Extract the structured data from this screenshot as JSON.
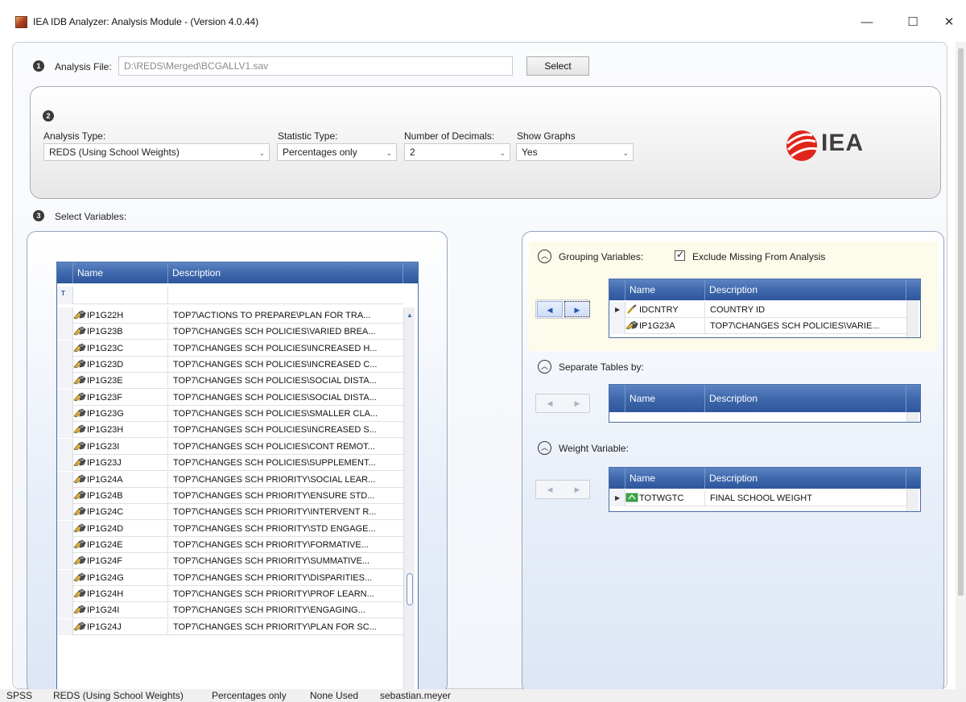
{
  "window": {
    "title": "IEA IDB Analyzer: Analysis Module - (Version 4.0.44)",
    "minimize": "—",
    "maximize": "☐",
    "close": "✕"
  },
  "step1": {
    "badge": "1",
    "label": "Analysis File:",
    "value": "D:\\REDS\\Merged\\BCGALLV1.sav",
    "select_button": "Select"
  },
  "step2": {
    "badge": "2",
    "analysis_type_label": "Analysis Type:",
    "analysis_type_value": "REDS (Using School Weights)",
    "statistic_type_label": "Statistic Type:",
    "statistic_type_value": "Percentages only",
    "decimals_label": "Number of Decimals:",
    "decimals_value": "2",
    "show_graphs_label": "Show Graphs",
    "show_graphs_value": "Yes",
    "logo_text": "IEA"
  },
  "step3": {
    "badge": "3",
    "label": "Select Variables:"
  },
  "variables_grid": {
    "columns": [
      "Name",
      "Description"
    ],
    "filter_symbol": "T",
    "rows": [
      {
        "name": "IP1G22H",
        "desc": "TOP7\\ACTIONS TO PREPARE\\PLAN FOR TRA..."
      },
      {
        "name": "IP1G23B",
        "desc": "TOP7\\CHANGES SCH POLICIES\\VARIED BREA..."
      },
      {
        "name": "IP1G23C",
        "desc": "TOP7\\CHANGES SCH POLICIES\\INCREASED H..."
      },
      {
        "name": "IP1G23D",
        "desc": "TOP7\\CHANGES SCH POLICIES\\INCREASED C..."
      },
      {
        "name": "IP1G23E",
        "desc": "TOP7\\CHANGES SCH POLICIES\\SOCIAL DISTA..."
      },
      {
        "name": "IP1G23F",
        "desc": "TOP7\\CHANGES SCH POLICIES\\SOCIAL DISTA..."
      },
      {
        "name": "IP1G23G",
        "desc": "TOP7\\CHANGES SCH POLICIES\\SMALLER CLA..."
      },
      {
        "name": "IP1G23H",
        "desc": "TOP7\\CHANGES SCH POLICIES\\INCREASED S..."
      },
      {
        "name": "IP1G23I",
        "desc": "TOP7\\CHANGES SCH POLICIES\\CONT REMOT..."
      },
      {
        "name": "IP1G23J",
        "desc": "TOP7\\CHANGES SCH POLICIES\\SUPPLEMENT..."
      },
      {
        "name": "IP1G24A",
        "desc": "TOP7\\CHANGES SCH PRIORITY\\SOCIAL LEAR..."
      },
      {
        "name": "IP1G24B",
        "desc": "TOP7\\CHANGES SCH PRIORITY\\ENSURE STD..."
      },
      {
        "name": "IP1G24C",
        "desc": "TOP7\\CHANGES SCH PRIORITY\\INTERVENT R..."
      },
      {
        "name": "IP1G24D",
        "desc": "TOP7\\CHANGES SCH PRIORITY\\STD ENGAGE..."
      },
      {
        "name": "IP1G24E",
        "desc": "TOP7\\CHANGES SCH PRIORITY\\FORMATIVE..."
      },
      {
        "name": "IP1G24F",
        "desc": "TOP7\\CHANGES SCH PRIORITY\\SUMMATIVE..."
      },
      {
        "name": "IP1G24G",
        "desc": "TOP7\\CHANGES SCH PRIORITY\\DISPARITIES..."
      },
      {
        "name": "IP1G24H",
        "desc": "TOP7\\CHANGES SCH PRIORITY\\PROF LEARN..."
      },
      {
        "name": "IP1G24I",
        "desc": "TOP7\\CHANGES SCH PRIORITY\\ENGAGING..."
      },
      {
        "name": "IP1G24J",
        "desc": "TOP7\\CHANGES SCH PRIORITY\\PLAN FOR SC..."
      }
    ]
  },
  "grouping": {
    "label": "Grouping Variables:",
    "exclude_missing_label": "Exclude Missing From Analysis",
    "exclude_missing_checked": true,
    "columns": [
      "Name",
      "Description"
    ],
    "rows": [
      {
        "name": "IDCNTRY",
        "desc": "COUNTRY ID"
      },
      {
        "name": "IP1G23A",
        "desc": "TOP7\\CHANGES SCH POLICIES\\VARIE..."
      }
    ]
  },
  "separate_tables": {
    "label": "Separate Tables by:",
    "columns": [
      "Name",
      "Description"
    ]
  },
  "weight": {
    "label": "Weight Variable:",
    "columns": [
      "Name",
      "Description"
    ],
    "rows": [
      {
        "name": "TOTWGTC",
        "desc": "FINAL SCHOOL WEIGHT"
      }
    ]
  },
  "statusbar": {
    "items": [
      "SPSS",
      "REDS (Using School Weights)",
      "Percentages only",
      "None Used",
      "sebastian.meyer"
    ]
  },
  "icons": {
    "collapse": "chevron-up-icon",
    "move_left": "arrow-left-icon",
    "move_right": "arrow-right-icon"
  },
  "colors": {
    "grid_header": "#3f68ad",
    "iea_red": "#e1251b",
    "panel_border": "#99a7bd"
  }
}
